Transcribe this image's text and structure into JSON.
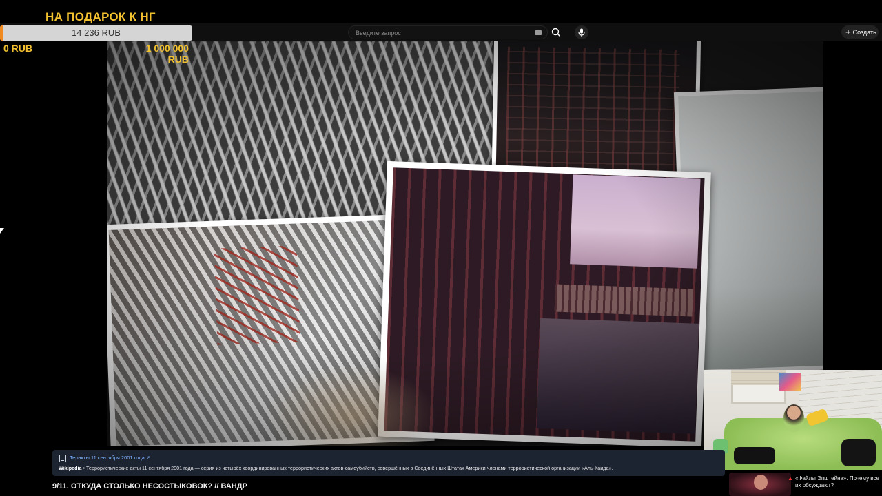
{
  "donation": {
    "title": "НА ПОДАРОК К НГ",
    "current": "14 236 RUB",
    "min": "0 RUB",
    "max": "1 000 000 RUB",
    "progress_fraction": 0.0142,
    "accent_color": "#f3c130",
    "fill_color": "#f08a20"
  },
  "header": {
    "search": {
      "placeholder": "Введите запрос",
      "value": ""
    },
    "search_icon": "search-icon",
    "mic_icon": "mic-icon",
    "keyboard_icon": "keyboard-icon",
    "create_label": "Создать"
  },
  "video": {
    "title": "9/11. ОТКУДА СТОЛЬКО НЕСОСТЫКОВОК? // ВАНДР"
  },
  "info_panel": {
    "link": "Теракты 11 сентября 2001 года ↗",
    "source": "Wikipedia",
    "text": " • Террористические акты 11 сентября 2001 года — серия из четырёх координированных террористических актов-самоубийств, совершённых в Соединённых Штатах Америки членами террористической организации «Аль-Каида».",
    "link_color": "#7fb2ff",
    "background": "#1c2431"
  },
  "recommendation": {
    "title": "«Файлы Эпштейна». Почему все их обсуждают?"
  }
}
